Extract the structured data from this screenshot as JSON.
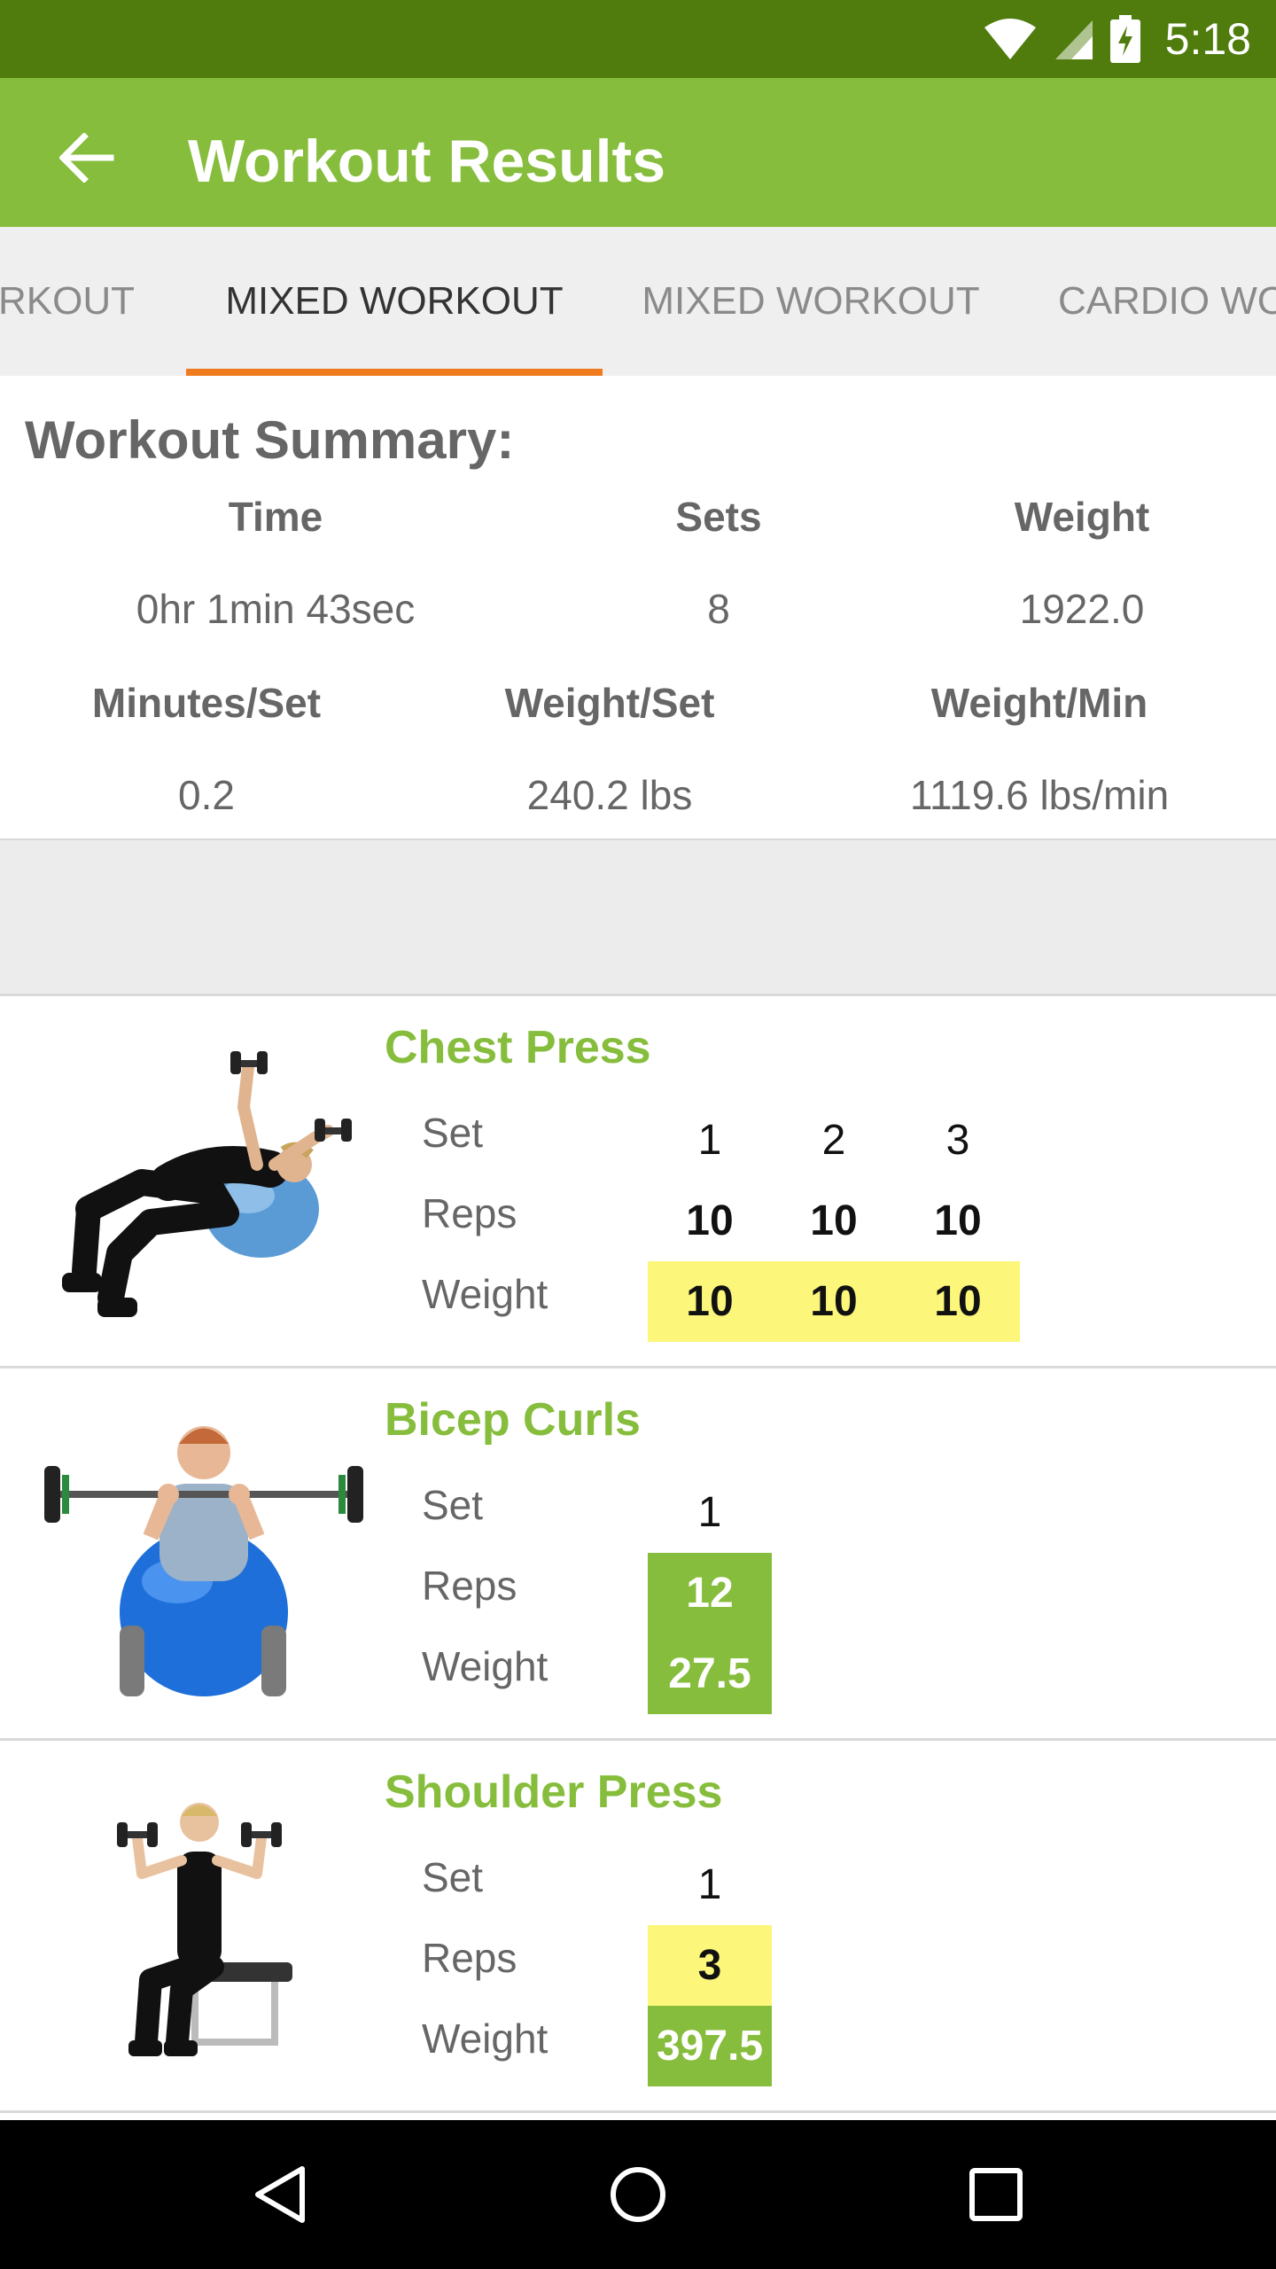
{
  "status": {
    "time": "5:18"
  },
  "appbar": {
    "title": "Workout Results"
  },
  "tabs": [
    "RKOUT",
    "MIXED WORKOUT",
    "MIXED WORKOUT",
    "CARDIO WO"
  ],
  "summary": {
    "title": "Workout Summary:",
    "row1_headers": [
      "Time",
      "Sets",
      "Weight"
    ],
    "row1_values": [
      "0hr 1min 43sec",
      "8",
      "1922.0"
    ],
    "row2_headers": [
      "Minutes/Set",
      "Weight/Set",
      "Weight/Min"
    ],
    "row2_values": [
      "0.2",
      "240.2 lbs",
      "1119.6 lbs/min"
    ]
  },
  "row_labels": {
    "set": "Set",
    "reps": "Reps",
    "weight": "Weight"
  },
  "exercises": [
    {
      "name": "Chest Press",
      "sets": [
        "1",
        "2",
        "3"
      ],
      "reps": [
        "10",
        "10",
        "10"
      ],
      "weights": [
        "10",
        "10",
        "10"
      ]
    },
    {
      "name": "Bicep Curls",
      "sets": [
        "1"
      ],
      "reps": [
        "12"
      ],
      "weights": [
        "27.5"
      ]
    },
    {
      "name": "Shoulder Press",
      "sets": [
        "1"
      ],
      "reps": [
        "3"
      ],
      "weights": [
        "397.5"
      ]
    }
  ],
  "colors": {
    "status_bar": "#4f7c0c",
    "app_bar": "#86bd3c",
    "tab_indicator": "#f07a1e",
    "highlight_yellow": "#fcf67a",
    "highlight_green": "#86bd3c"
  }
}
